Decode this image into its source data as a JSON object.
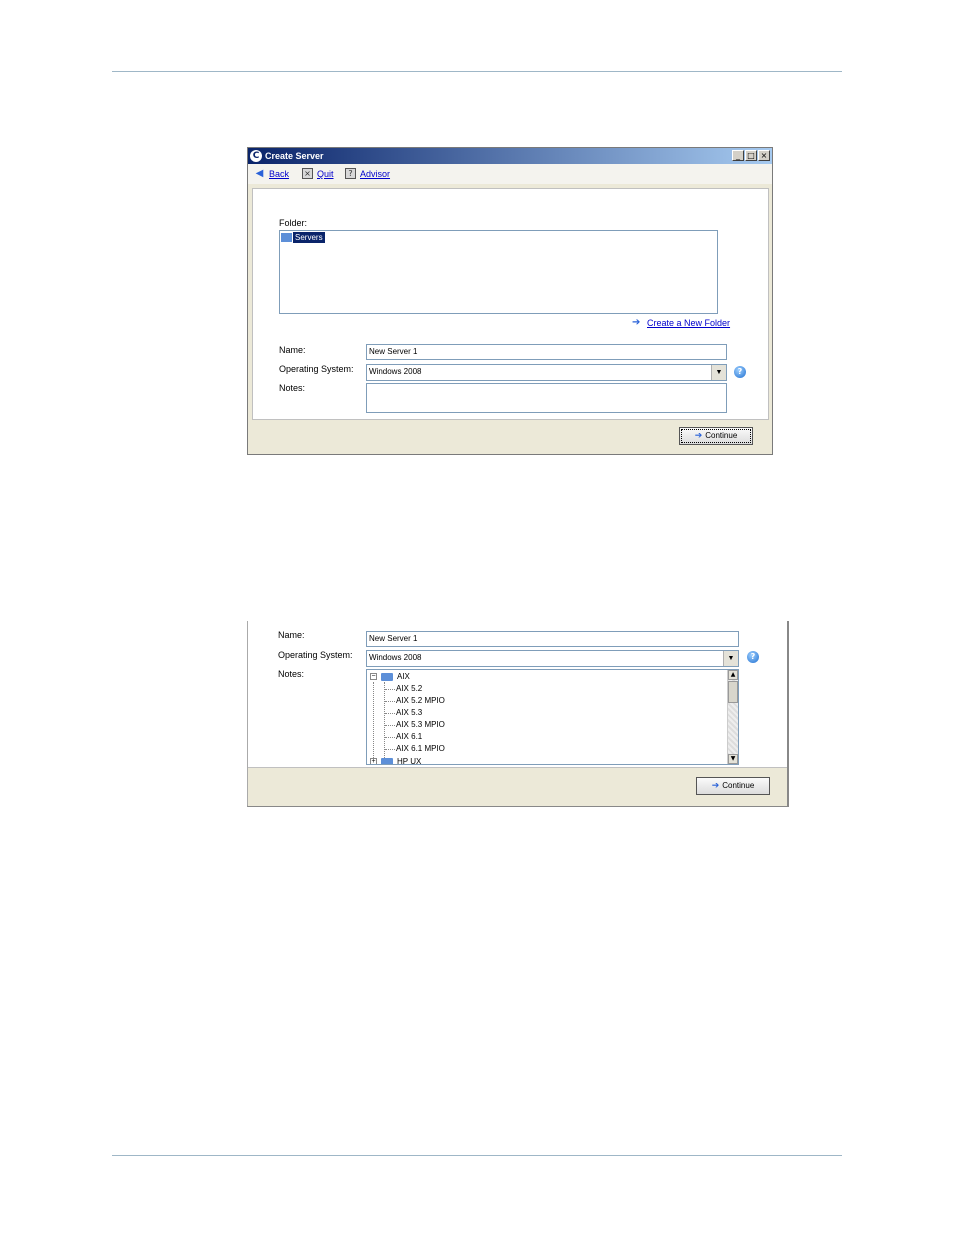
{
  "window1": {
    "title": "Create Server",
    "toolbar": {
      "back": "Back",
      "quit": "Quit",
      "advisor": "Advisor"
    },
    "folder_label": "Folder:",
    "folder_item": "Servers",
    "create_folder_link": "Create a New Folder",
    "name_label": "Name:",
    "name_value": "New Server 1",
    "os_label": "Operating System:",
    "os_value": "Windows 2008",
    "notes_label": "Notes:",
    "continue_label": "Continue"
  },
  "window2": {
    "name_label": "Name:",
    "name_value": "New Server 1",
    "os_label": "Operating System:",
    "os_value": "Windows 2008",
    "notes_label": "Notes:",
    "tree": {
      "group1": "AIX",
      "items": [
        "AIX 5.2",
        "AIX 5.2 MPIO",
        "AIX 5.3",
        "AIX 5.3 MPIO",
        "AIX 6.1",
        "AIX 6.1 MPIO"
      ],
      "group2": "HP UX"
    },
    "continue_label": "Continue"
  },
  "icons": {
    "back": "arrow-left-icon",
    "quit": "close-box-icon",
    "advisor": "help-box-icon",
    "help": "question-icon",
    "folder": "folder-icon",
    "servers": "servers-icon"
  }
}
